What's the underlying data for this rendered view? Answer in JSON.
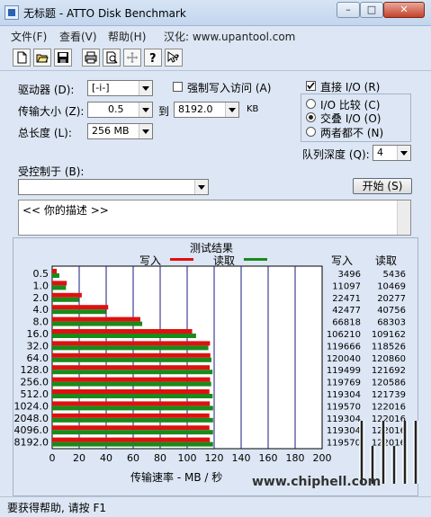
{
  "window": {
    "title": "无标题 - ATTO Disk Benchmark"
  },
  "menu": {
    "file": "文件(F)",
    "view": "查看(V)",
    "help": "帮助(H)",
    "sinicize": "汉化: www.upantool.com"
  },
  "toolbar": {
    "icons": [
      "new-file-icon",
      "open-folder-icon",
      "save-icon",
      "print-icon",
      "print-preview-icon",
      "move-icon",
      "help-icon",
      "context-help-icon"
    ]
  },
  "form": {
    "drive_label": "驱动器 (D):",
    "drive_value": "[-i-]",
    "transfer_label": "传输大小 (Z):",
    "transfer_from": "0.5",
    "to_label": "到",
    "transfer_to": "8192.0",
    "kb_label": "KB",
    "length_label": "总长度 (L):",
    "length_value": "256 MB",
    "force_write_label": "强制写入访问 (A)",
    "force_write_checked": false,
    "direct_io_label": "直接 I/O (R)",
    "direct_io_checked": true,
    "io_compare_label": "I/O 比较 (C)",
    "overlap_io_label": "交叠 I/O (O)",
    "neither_label": "两者都不 (N)",
    "selected_mode": "overlap",
    "queue_label": "队列深度 (Q):",
    "queue_value": "4",
    "controlled_by_label": "受控制于 (B):",
    "controlled_by_value": "",
    "start_button": "开始 (S)",
    "description": "<<  你的描述   >>"
  },
  "results": {
    "title": "测试结果",
    "legend_write": "写入",
    "legend_read": "读取",
    "col_write": "写入",
    "col_read": "读取",
    "xlabel": "传输速率 - MB / 秒"
  },
  "chart_data": {
    "type": "bar",
    "orientation": "horizontal",
    "title": "测试结果",
    "xlabel": "传输速率 - MB / 秒",
    "xlim": [
      0,
      200
    ],
    "xticks": [
      "0",
      "20",
      "40",
      "60",
      "80",
      "100",
      "120",
      "140",
      "160",
      "180",
      "200"
    ],
    "categories": [
      "0.5",
      "1.0",
      "2.0",
      "4.0",
      "8.0",
      "16.0",
      "32.0",
      "64.0",
      "128.0",
      "256.0",
      "512.0",
      "1024.0",
      "2048.0",
      "4096.0",
      "8192.0"
    ],
    "series": [
      {
        "name": "写入",
        "color": "#e01010",
        "values_kb": [
          3496,
          11097,
          22471,
          42477,
          66818,
          106210,
          119666,
          120040,
          119499,
          119769,
          119304,
          119570,
          119304,
          119304,
          119570
        ],
        "values_mb": [
          3.4,
          10.8,
          21.9,
          41.5,
          65.3,
          103.7,
          116.9,
          117.2,
          116.7,
          117.0,
          116.5,
          116.8,
          116.5,
          116.5,
          116.8
        ]
      },
      {
        "name": "读取",
        "color": "#1a8a1a",
        "values_kb": [
          5436,
          10469,
          20277,
          40756,
          68303,
          109162,
          118526,
          120860,
          121692,
          120586,
          121739,
          122016,
          122016,
          122016,
          122016
        ],
        "values_mb": [
          5.3,
          10.2,
          19.8,
          39.8,
          66.7,
          106.6,
          115.7,
          118.0,
          118.8,
          117.8,
          118.9,
          119.2,
          119.2,
          119.2,
          119.2
        ]
      }
    ],
    "write_col_text": [
      "3496",
      "11097",
      "22471",
      "42477",
      "66818",
      "106210",
      "119666",
      "120040",
      "119499",
      "119769",
      "119304",
      "119570",
      "119304",
      "119304",
      "119570"
    ],
    "read_col_text": [
      "5436",
      "10469",
      "20277",
      "40756",
      "68303",
      "109162",
      "118526",
      "120860",
      "121692",
      "120586",
      "121739",
      "122016",
      "122016",
      "122016",
      "122016"
    ]
  },
  "status": {
    "text": "要获得帮助, 请按 F1"
  },
  "watermark": {
    "text": "www.chiphell.com"
  }
}
